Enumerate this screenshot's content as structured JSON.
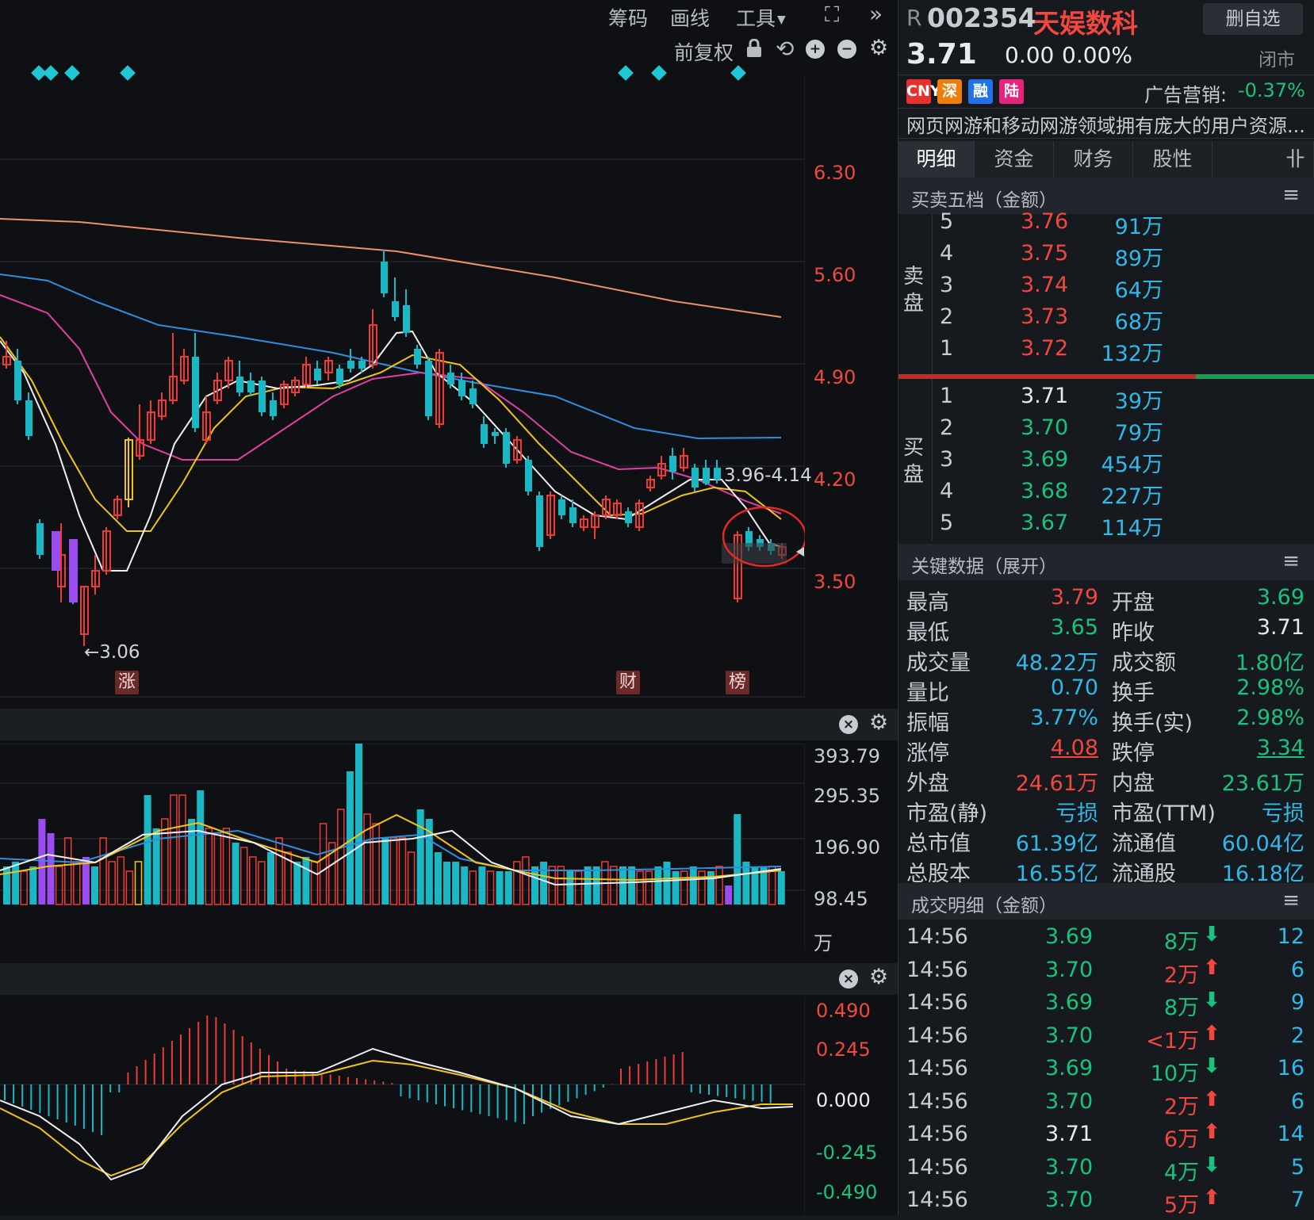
{
  "toolbar": {
    "chips_label": "筹码",
    "draw_label": "画线",
    "tools_label": "工具",
    "adjust_label": "前复权"
  },
  "main_chart": {
    "price_ticks": [
      "6.30",
      "5.60",
      "4.90",
      "4.20",
      "3.50"
    ],
    "range_label": "3.96-4.14",
    "low_label": "←3.06",
    "event_markers": [
      "涨",
      "财",
      "榜"
    ]
  },
  "volume_chart": {
    "ticks": [
      "393.79",
      "295.35",
      "196.90",
      "98.45"
    ],
    "unit": "万"
  },
  "macd_chart": {
    "ticks": [
      "0.490",
      "0.245",
      "0.000",
      "-0.245",
      "-0.490"
    ]
  },
  "stock": {
    "flag": "R",
    "code": "002354",
    "name": "天娱数科",
    "remove_watch_label": "删自选",
    "price": "3.71",
    "change": "0.00",
    "change_pct": "0.00%",
    "status": "闭市",
    "badges": [
      "CNY",
      "深",
      "融",
      "陆"
    ],
    "badge_colors": [
      "#e8312d",
      "#f07c0c",
      "#1f72e8",
      "#e8237d"
    ],
    "sector_label": "广告营销:",
    "sector_change": "-0.37%",
    "description": "网页网游和移动网游领域拥有庞大的用户资源..."
  },
  "tabs": [
    "明细",
    "资金",
    "财务",
    "股性"
  ],
  "tab_more": "卝",
  "orderbook": {
    "title": "买卖五档（金额）",
    "sell_label": [
      "卖",
      "盘"
    ],
    "buy_label": [
      "买",
      "盘"
    ],
    "asks": [
      {
        "level": "5",
        "price": "3.76",
        "amount": "91万"
      },
      {
        "level": "4",
        "price": "3.75",
        "amount": "89万"
      },
      {
        "level": "3",
        "price": "3.74",
        "amount": "64万"
      },
      {
        "level": "2",
        "price": "3.73",
        "amount": "68万"
      },
      {
        "level": "1",
        "price": "3.72",
        "amount": "132万"
      }
    ],
    "bids": [
      {
        "level": "1",
        "price": "3.71",
        "amount": "39万"
      },
      {
        "level": "2",
        "price": "3.70",
        "amount": "79万"
      },
      {
        "level": "3",
        "price": "3.69",
        "amount": "454万"
      },
      {
        "level": "4",
        "price": "3.68",
        "amount": "227万"
      },
      {
        "level": "5",
        "price": "3.67",
        "amount": "114万"
      }
    ]
  },
  "key_data": {
    "title": "关键数据（展开）",
    "rows": [
      [
        {
          "label": "最高",
          "value": "3.79"
        },
        {
          "label": "开盘",
          "value": "3.69"
        }
      ],
      [
        {
          "label": "最低",
          "value": "3.65"
        },
        {
          "label": "昨收",
          "value": "3.71"
        }
      ],
      [
        {
          "label": "成交量",
          "value": "48.22万"
        },
        {
          "label": "成交额",
          "value": "1.80亿"
        }
      ],
      [
        {
          "label": "量比",
          "value": "0.70"
        },
        {
          "label": "换手",
          "value": "2.98%"
        }
      ],
      [
        {
          "label": "振幅",
          "value": "3.77%"
        },
        {
          "label": "换手(实)",
          "value": "2.98%"
        }
      ],
      [
        {
          "label": "涨停",
          "value": "4.08"
        },
        {
          "label": "跌停",
          "value": "3.34"
        }
      ],
      [
        {
          "label": "外盘",
          "value": "24.61万"
        },
        {
          "label": "内盘",
          "value": "23.61万"
        }
      ],
      [
        {
          "label": "市盈(静)",
          "value": "亏损"
        },
        {
          "label": "市盈(TTM)",
          "value": "亏损"
        }
      ],
      [
        {
          "label": "总市值",
          "value": "61.39亿"
        },
        {
          "label": "流通值",
          "value": "60.04亿"
        }
      ],
      [
        {
          "label": "总股本",
          "value": "16.55亿"
        },
        {
          "label": "流通股",
          "value": "16.18亿"
        }
      ]
    ]
  },
  "trades": {
    "title": "成交明细（金额）",
    "rows": [
      {
        "time": "14:56",
        "price": "3.69",
        "amount": "8万",
        "dir": "down",
        "count": "12"
      },
      {
        "time": "14:56",
        "price": "3.70",
        "amount": "2万",
        "dir": "up",
        "count": "6"
      },
      {
        "time": "14:56",
        "price": "3.69",
        "amount": "8万",
        "dir": "down",
        "count": "9"
      },
      {
        "time": "14:56",
        "price": "3.70",
        "amount": "<1万",
        "dir": "up",
        "count": "2"
      },
      {
        "time": "14:56",
        "price": "3.69",
        "amount": "10万",
        "dir": "down",
        "count": "16"
      },
      {
        "time": "14:56",
        "price": "3.70",
        "amount": "2万",
        "dir": "up",
        "count": "6"
      },
      {
        "time": "14:56",
        "price": "3.71",
        "amount": "6万",
        "dir": "up",
        "count": "14"
      },
      {
        "time": "14:56",
        "price": "3.70",
        "amount": "4万",
        "dir": "down",
        "count": "5"
      },
      {
        "time": "14:56",
        "price": "3.70",
        "amount": "5万",
        "dir": "up",
        "count": "7"
      }
    ]
  }
}
